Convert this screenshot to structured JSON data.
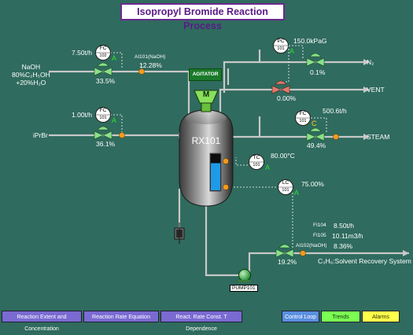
{
  "title": "Isopropyl Bromide Reaction Process",
  "agitator_label": "AGITATOR",
  "agitator_glyph": "M",
  "reactor_label": "RX101",
  "pump_label": "PUMP101",
  "feeds": {
    "naoh": "NaOH\n80%C₂H₅OH\n+20%H₂O",
    "iprbr": "iPrBr"
  },
  "outlets": {
    "n2": "N₂",
    "vent": "VENT",
    "steam": "STEAM",
    "solvent": "C₃H₆:Solvent Recovery System"
  },
  "controllers": {
    "fc102": {
      "tag": "FC",
      "num": "102",
      "mode": "A",
      "pv": "7.50t/h",
      "out": "33.5%"
    },
    "fc101": {
      "tag": "FC",
      "num": "101",
      "mode": "A",
      "pv": "1.00t/h",
      "out": "36.1%"
    },
    "pc101": {
      "tag": "PC",
      "num": "101",
      "mode": "A",
      "pv": "150.0kPaG",
      "out_n2": "0.1%",
      "out_vent": "0.00%"
    },
    "fc_steam": {
      "tag": "FC",
      "num": "101",
      "mode": "C",
      "pv": "500.6t/h",
      "out": "49.4%"
    },
    "tc101": {
      "tag": "TC",
      "num": "101",
      "mode": "A",
      "pv": "80.00°C"
    },
    "lc101": {
      "tag": "LC",
      "num": "101",
      "mode": "A",
      "pv": "75.00%",
      "out": "19.2%"
    }
  },
  "analyzers": {
    "ai101_label": "AI101(NaOH)",
    "ai101_value": "12.28%",
    "ai102_label": "AI102(NaOH)",
    "ai102_value": "8.36%",
    "fi104_label": "FI104",
    "fi104_value": "8.50t/h",
    "fi105_label": "FI105",
    "fi105_value": "10.11m3/h"
  },
  "level_fraction": 0.75,
  "buttons": {
    "extent": "Reaction Extent and Concentration",
    "rate_eq": "Reaction Rate Equation",
    "rate_const": "React. Rate Const. T Dependence",
    "control_loop": "Control Loop",
    "trends": "Trends",
    "alarms": "Alarms"
  },
  "colors": {
    "background": "#2f6b5e",
    "pipe": "#c8c8c8",
    "valve": "#8ae08a",
    "valve_vent": "#e07a6a",
    "sensor_dot": "#f59a1a",
    "mode": "#2fe02f",
    "mode_cascade": "#ffd21a",
    "level_fill": "#1e9ae8"
  }
}
